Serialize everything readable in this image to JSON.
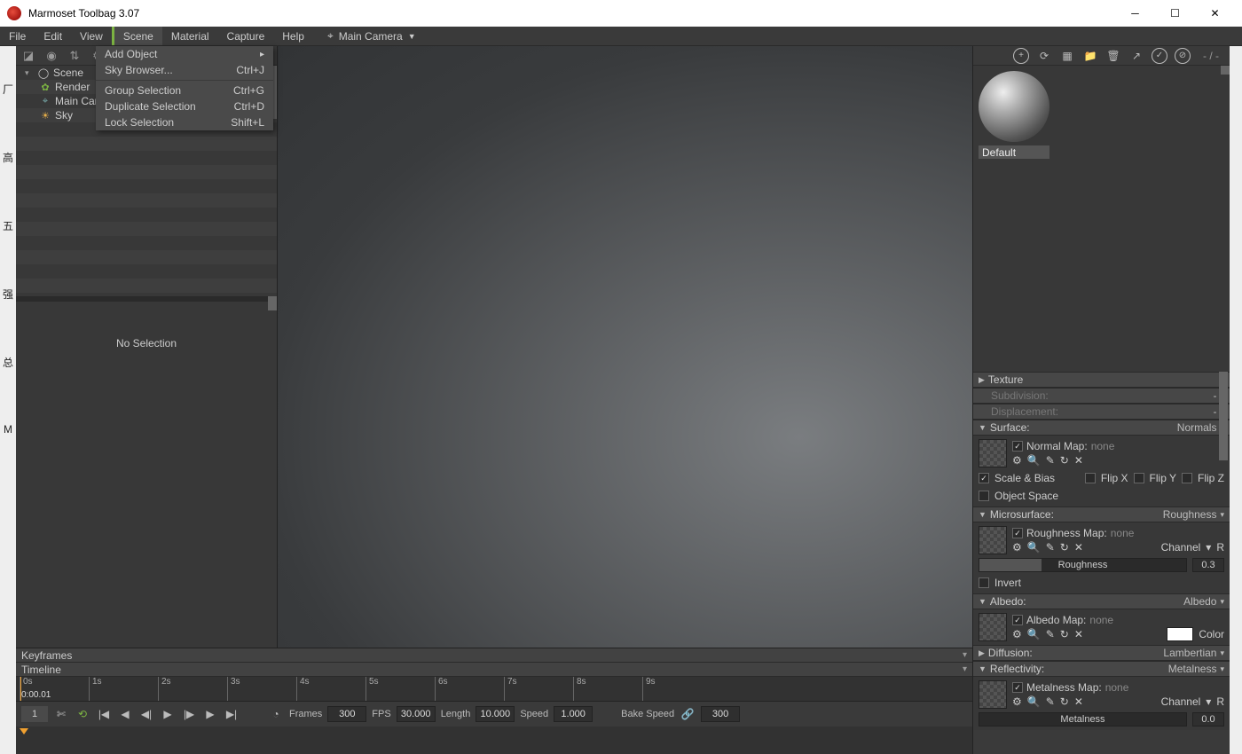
{
  "window": {
    "title": "Marmoset Toolbag 3.07"
  },
  "menu": {
    "items": [
      "File",
      "Edit",
      "View",
      "Scene",
      "Material",
      "Capture",
      "Help"
    ],
    "active": "Scene",
    "camera": "Main Camera"
  },
  "dropdown": {
    "items": [
      {
        "label": "Add Object",
        "shortcut": "",
        "sub": true
      },
      {
        "label": "Sky Browser...",
        "shortcut": "Ctrl+J"
      },
      {
        "sep": true
      },
      {
        "label": "Group Selection",
        "shortcut": "Ctrl+G"
      },
      {
        "label": "Duplicate Selection",
        "shortcut": "Ctrl+D"
      },
      {
        "label": "Lock Selection",
        "shortcut": "Shift+L"
      }
    ]
  },
  "hierarchy": {
    "root": "Scene",
    "children": [
      {
        "name": "Render",
        "icon": "gear",
        "color": "#7cb342"
      },
      {
        "name": "Main Cam",
        "icon": "camera",
        "color": "#7aa"
      },
      {
        "name": "Sky",
        "icon": "sky",
        "color": "#e8b04a"
      }
    ]
  },
  "inspector": {
    "empty": "No Selection"
  },
  "timeline": {
    "keyframes": "Keyframes",
    "timeline": "Timeline",
    "ticks": [
      "0s",
      "1s",
      "2s",
      "3s",
      "4s",
      "5s",
      "6s",
      "7s",
      "8s",
      "9s"
    ],
    "time": "0:00.01",
    "frame": "1",
    "frames_lbl": "Frames",
    "frames": "300",
    "fps_lbl": "FPS",
    "fps": "30.000",
    "length_lbl": "Length",
    "length": "10.000",
    "speed_lbl": "Speed",
    "speed": "1.000",
    "bake_lbl": "Bake Speed",
    "bake": "300"
  },
  "material": {
    "name": "Default",
    "count": "- / -",
    "sections": {
      "texture": {
        "label": "Texture"
      },
      "subdivision": {
        "label": "Subdivision:",
        "sel": "- "
      },
      "displacement": {
        "label": "Displacement:",
        "sel": "- "
      },
      "surface": {
        "label": "Surface:",
        "sel": "Normals",
        "normal_map": "Normal Map:",
        "none": "none",
        "scale_bias": "Scale & Bias",
        "flipx": "Flip X",
        "flipy": "Flip Y",
        "flipz": "Flip Z",
        "object_space": "Object Space"
      },
      "microsurface": {
        "label": "Microsurface:",
        "sel": "Roughness",
        "rough_map": "Roughness Map:",
        "none": "none",
        "channel": "Channel",
        "channel_val": "R",
        "roughness": "Roughness",
        "value": "0.3",
        "invert": "Invert"
      },
      "albedo": {
        "label": "Albedo:",
        "sel": "Albedo",
        "map": "Albedo Map:",
        "none": "none",
        "color": "Color"
      },
      "diffusion": {
        "label": "Diffusion:",
        "sel": "Lambertian"
      },
      "reflectivity": {
        "label": "Reflectivity:",
        "sel": "Metalness",
        "map": "Metalness Map:",
        "none": "none",
        "channel": "Channel",
        "channel_val": "R",
        "metalness": "Metalness",
        "value": "0.0"
      }
    }
  }
}
